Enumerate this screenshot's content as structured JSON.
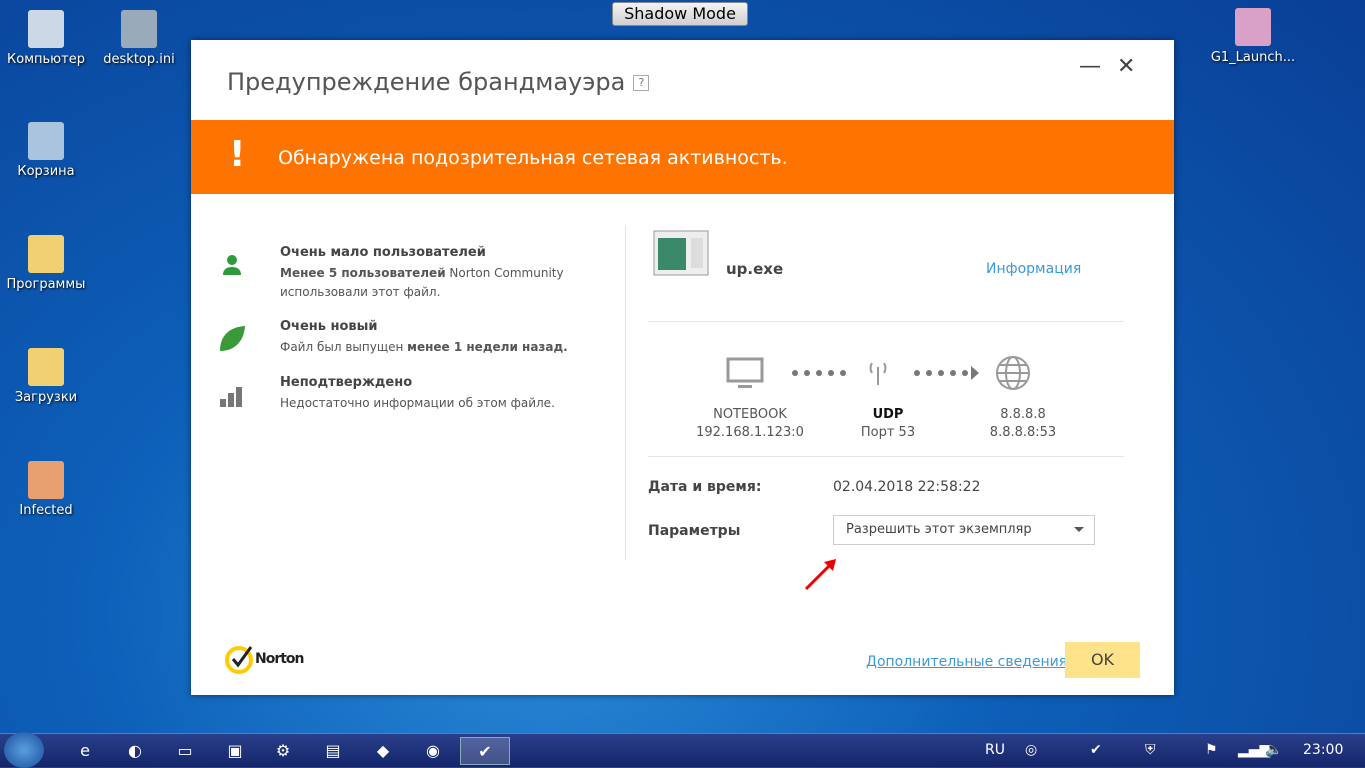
{
  "desktop": {
    "icons": [
      "Компьютер",
      "desktop.ini",
      "Корзина",
      "Программы",
      "Загрузки",
      "Infected",
      "G1_Launch..."
    ]
  },
  "shadow_mode": "Shadow Mode",
  "dialog": {
    "title": "Предупреждение брандмауэра",
    "help": "?",
    "minimize": "—",
    "close": "✕",
    "banner": {
      "icon": "!",
      "text": "Обнаружена подозрительная сетевая активность."
    },
    "items": [
      {
        "icon": "user-icon",
        "heading": "Очень мало пользователей",
        "bold": "Менее 5 пользователей",
        "text": " Norton Community",
        "text2": "использовали этот файл."
      },
      {
        "icon": "leaf-icon",
        "heading": "Очень новый",
        "text": "Файл был выпущен ",
        "bold": "менее 1 недели назад."
      },
      {
        "icon": "signal-bars-icon",
        "heading": "Неподтверждено",
        "text": "Недостаточно информации об этом файле."
      }
    ],
    "file": {
      "name": "up.exe",
      "info_link": "Информация"
    },
    "connection": {
      "source": {
        "name": "NOTEBOOK",
        "address": "192.168.1.123:0"
      },
      "protocol": {
        "name": "UDP",
        "port": "Порт 53"
      },
      "destination": {
        "name": "8.8.8.8",
        "address": "8.8.8.8:53"
      }
    },
    "datetime_label": "Дата и время:",
    "datetime_value": "02.04.2018 22:58:22",
    "params_label": "Параметры",
    "params_value": "Разрешить этот экземпляр",
    "logo": "Norton by Symantec",
    "more_link": "Дополнительные сведения",
    "ok": "OK"
  },
  "taskbar": {
    "lang": "RU",
    "clock": "23:00"
  },
  "colors": {
    "accent": "#ff7300",
    "link": "#3b9ad8",
    "ok": "#ffe38a"
  }
}
